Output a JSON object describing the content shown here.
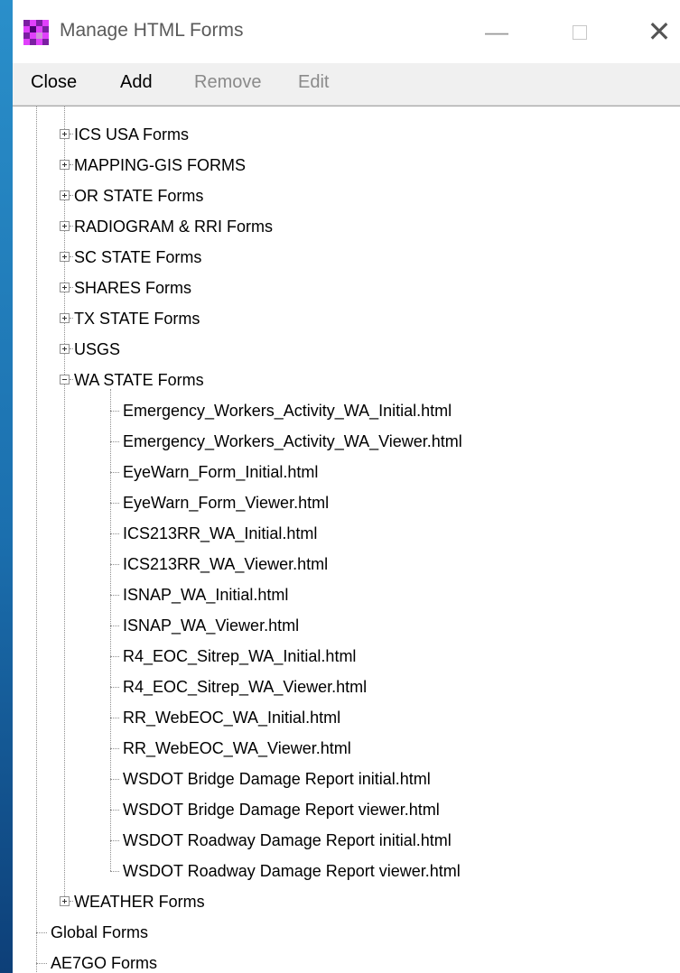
{
  "window": {
    "title": "Manage HTML Forms",
    "icon_colors": [
      "#7b1fa2",
      "#e040fb",
      "#4a0072",
      "#ce93d8"
    ]
  },
  "controls": {
    "minimize": "—",
    "close": "✕"
  },
  "menu": {
    "close": "Close",
    "add": "Add",
    "remove": "Remove",
    "edit": "Edit"
  },
  "tree": {
    "collapsed_groups": [
      "ICS USA Forms",
      "MAPPING-GIS FORMS",
      "OR STATE Forms",
      "RADIOGRAM & RRI Forms",
      "SC STATE Forms",
      "SHARES Forms",
      "TX STATE Forms",
      "USGS"
    ],
    "expanded_group": "WA STATE Forms",
    "wa_files": [
      "Emergency_Workers_Activity_WA_Initial.html",
      "Emergency_Workers_Activity_WA_Viewer.html",
      "EyeWarn_Form_Initial.html",
      "EyeWarn_Form_Viewer.html",
      "ICS213RR_WA_Initial.html",
      "ICS213RR_WA_Viewer.html",
      "ISNAP_WA_Initial.html",
      "ISNAP_WA_Viewer.html",
      "R4_EOC_Sitrep_WA_Initial.html",
      "R4_EOC_Sitrep_WA_Viewer.html",
      "RR_WebEOC_WA_Initial.html",
      "RR_WebEOC_WA_Viewer.html",
      "WSDOT Bridge Damage Report initial.html",
      "WSDOT Bridge Damage Report viewer.html",
      "WSDOT Roadway Damage Report initial.html",
      "WSDOT Roadway Damage Report viewer.html"
    ],
    "after_group": "WEATHER Forms",
    "root_items": [
      "Global Forms",
      "AE7GO Forms"
    ]
  }
}
